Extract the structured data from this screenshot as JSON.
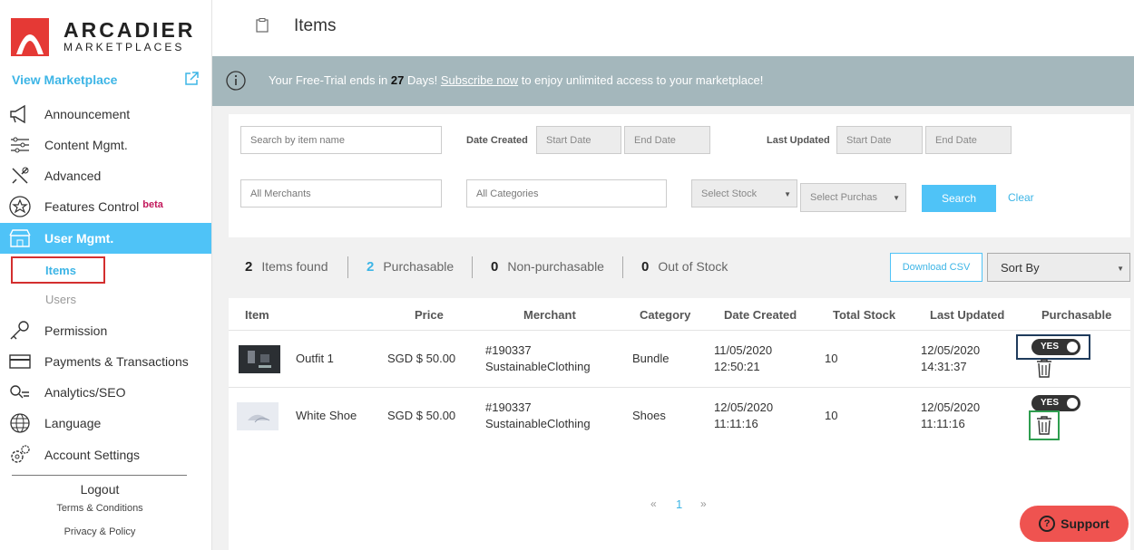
{
  "brand": {
    "name_line1": "ARCADIER",
    "name_line2": "MARKETPLACES",
    "accent": "#e53935"
  },
  "sidebar": {
    "view_marketplace": "View Marketplace",
    "items": [
      {
        "label": "Announcement",
        "icon": "megaphone-icon"
      },
      {
        "label": "Content Mgmt.",
        "icon": "sliders-icon"
      },
      {
        "label": "Advanced",
        "icon": "tools-icon"
      },
      {
        "label": "Features Control",
        "icon": "star-icon",
        "badge": "beta"
      },
      {
        "label": "User Mgmt.",
        "icon": "store-icon",
        "active": true
      },
      {
        "label": "Permission",
        "icon": "key-icon"
      },
      {
        "label": "Payments & Transactions",
        "icon": "card-icon"
      },
      {
        "label": "Analytics/SEO",
        "icon": "search-graph-icon"
      },
      {
        "label": "Language",
        "icon": "globe-icon"
      },
      {
        "label": "Account Settings",
        "icon": "gears-icon"
      }
    ],
    "subitems": {
      "items": "Items",
      "users": "Users"
    },
    "logout": "Logout",
    "terms": "Terms & Conditions",
    "privacy": "Privacy & Policy"
  },
  "header": {
    "title": "Items"
  },
  "banner": {
    "pre": "Your Free-Trial ends in ",
    "days": "27",
    "mid": " Days! ",
    "link": "Subscribe now",
    "post": " to enjoy unlimited access to your marketplace!"
  },
  "filters": {
    "search_placeholder": "Search by item name",
    "date_created_label": "Date Created",
    "last_updated_label": "Last Updated",
    "start_date": "Start Date",
    "end_date": "End Date",
    "merchants": "All Merchants",
    "categories": "All Categories",
    "stock": "Select Stock",
    "purchasable": "Select Purchas",
    "search_btn": "Search",
    "clear_btn": "Clear"
  },
  "stats": {
    "found_count": "2",
    "found_label": "Items found",
    "purch_count": "2",
    "purch_label": "Purchasable",
    "nonpurch_count": "0",
    "nonpurch_label": "Non-purchasable",
    "oos_count": "0",
    "oos_label": "Out of Stock",
    "csv_btn": "Download CSV",
    "sort_by": "Sort By"
  },
  "table": {
    "headers": [
      "Item",
      "Price",
      "Merchant",
      "Category",
      "Date Created",
      "Total Stock",
      "Last Updated",
      "Purchasable"
    ],
    "rows": [
      {
        "name": "Outfit 1",
        "price": "SGD $ 50.00",
        "merchant_id": "#190337",
        "merchant_name": "SustainableClothing",
        "category": "Bundle",
        "created_date": "11/05/2020",
        "created_time": "12:50:21",
        "stock": "10",
        "updated_date": "12/05/2020",
        "updated_time": "14:31:37",
        "purchasable": "YES"
      },
      {
        "name": "White Shoe",
        "price": "SGD $ 50.00",
        "merchant_id": "#190337",
        "merchant_name": "SustainableClothing",
        "category": "Shoes",
        "created_date": "12/05/2020",
        "created_time": "11:11:16",
        "stock": "10",
        "updated_date": "12/05/2020",
        "updated_time": "11:11:16",
        "purchasable": "YES"
      }
    ]
  },
  "pagination": {
    "prev": "«",
    "current": "1",
    "next": "»"
  },
  "support": {
    "label": "Support",
    "q": "?"
  }
}
